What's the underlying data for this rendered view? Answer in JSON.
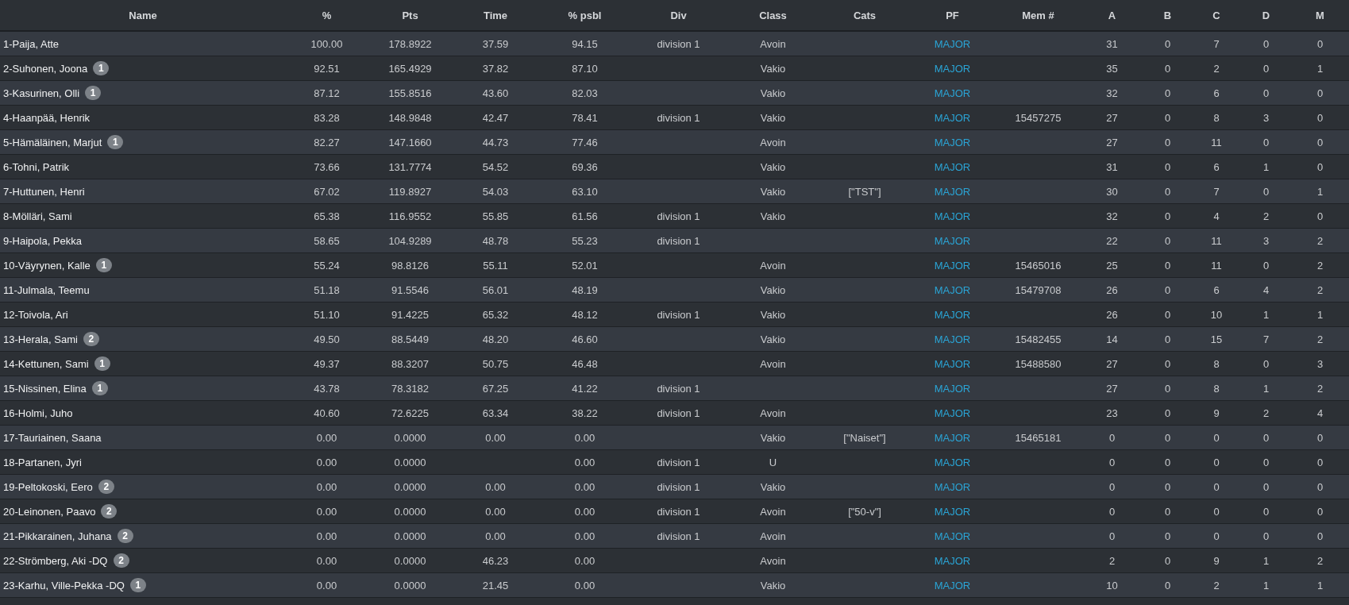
{
  "table": {
    "columns": [
      "Name",
      "%",
      "Pts",
      "Time",
      "% psbl",
      "Div",
      "Class",
      "Cats",
      "PF",
      "Mem #",
      "A",
      "B",
      "C",
      "D",
      "M"
    ],
    "rows": [
      {
        "cells": [
          "1-Paija, Atte",
          "100.00",
          "178.8922",
          "37.59",
          "94.15",
          "division 1",
          "Avoin",
          null,
          "MAJOR",
          null,
          "31",
          "0",
          "7",
          "0",
          "0"
        ]
      },
      {
        "badge": "1",
        "cells": [
          "2-Suhonen, Joona",
          "92.51",
          "165.4929",
          "37.82",
          "87.10",
          null,
          "Vakio",
          null,
          "MAJOR",
          null,
          "35",
          "0",
          "2",
          "0",
          "1"
        ]
      },
      {
        "badge": "1",
        "cells": [
          "3-Kasurinen, Olli",
          "87.12",
          "155.8516",
          "43.60",
          "82.03",
          null,
          "Vakio",
          null,
          "MAJOR",
          null,
          "32",
          "0",
          "6",
          "0",
          "0"
        ]
      },
      {
        "cells": [
          "4-Haanpää, Henrik",
          "83.28",
          "148.9848",
          "42.47",
          "78.41",
          "division 1",
          "Vakio",
          null,
          "MAJOR",
          "15457275",
          "27",
          "0",
          "8",
          "3",
          "0"
        ]
      },
      {
        "badge": "1",
        "cells": [
          "5-Hämäläinen, Marjut",
          "82.27",
          "147.1660",
          "44.73",
          "77.46",
          null,
          "Avoin",
          null,
          "MAJOR",
          null,
          "27",
          "0",
          "11",
          "0",
          "0"
        ]
      },
      {
        "cells": [
          "6-Tohni, Patrik",
          "73.66",
          "131.7774",
          "54.52",
          "69.36",
          null,
          "Vakio",
          null,
          "MAJOR",
          null,
          "31",
          "0",
          "6",
          "1",
          "0"
        ]
      },
      {
        "cells": [
          "7-Huttunen, Henri",
          "67.02",
          "119.8927",
          "54.03",
          "63.10",
          null,
          "Vakio",
          "[\"TST\"]",
          "MAJOR",
          null,
          "30",
          "0",
          "7",
          "0",
          "1"
        ]
      },
      {
        "cells": [
          "8-Mölläri, Sami",
          "65.38",
          "116.9552",
          "55.85",
          "61.56",
          "division 1",
          "Vakio",
          null,
          "MAJOR",
          null,
          "32",
          "0",
          "4",
          "2",
          "0"
        ]
      },
      {
        "cells": [
          "9-Haipola, Pekka",
          "58.65",
          "104.9289",
          "48.78",
          "55.23",
          "division 1",
          null,
          null,
          "MAJOR",
          null,
          "22",
          "0",
          "11",
          "3",
          "2"
        ]
      },
      {
        "badge": "1",
        "cells": [
          "10-Väyrynen, Kalle",
          "55.24",
          "98.8126",
          "55.11",
          "52.01",
          null,
          "Avoin",
          null,
          "MAJOR",
          "15465016",
          "25",
          "0",
          "11",
          "0",
          "2"
        ]
      },
      {
        "cells": [
          "11-Julmala, Teemu",
          "51.18",
          "91.5546",
          "56.01",
          "48.19",
          null,
          "Vakio",
          null,
          "MAJOR",
          "15479708",
          "26",
          "0",
          "6",
          "4",
          "2"
        ]
      },
      {
        "cells": [
          "12-Toivola, Ari",
          "51.10",
          "91.4225",
          "65.32",
          "48.12",
          "division 1",
          "Vakio",
          null,
          "MAJOR",
          null,
          "26",
          "0",
          "10",
          "1",
          "1"
        ]
      },
      {
        "badge": "2",
        "cells": [
          "13-Herala, Sami",
          "49.50",
          "88.5449",
          "48.20",
          "46.60",
          null,
          "Vakio",
          null,
          "MAJOR",
          "15482455",
          "14",
          "0",
          "15",
          "7",
          "2"
        ]
      },
      {
        "badge": "1",
        "cells": [
          "14-Kettunen, Sami",
          "49.37",
          "88.3207",
          "50.75",
          "46.48",
          null,
          "Avoin",
          null,
          "MAJOR",
          "15488580",
          "27",
          "0",
          "8",
          "0",
          "3"
        ]
      },
      {
        "badge": "1",
        "cells": [
          "15-Nissinen, Elina",
          "43.78",
          "78.3182",
          "67.25",
          "41.22",
          "division 1",
          null,
          null,
          "MAJOR",
          null,
          "27",
          "0",
          "8",
          "1",
          "2"
        ]
      },
      {
        "cells": [
          "16-Holmi, Juho",
          "40.60",
          "72.6225",
          "63.34",
          "38.22",
          "division 1",
          "Avoin",
          null,
          "MAJOR",
          null,
          "23",
          "0",
          "9",
          "2",
          "4"
        ]
      },
      {
        "cells": [
          "17-Tauriainen, Saana",
          "0.00",
          "0.0000",
          "0.00",
          "0.00",
          null,
          "Vakio",
          "[\"Naiset\"]",
          "MAJOR",
          "15465181",
          "0",
          "0",
          "0",
          "0",
          "0"
        ]
      },
      {
        "cells": [
          "18-Partanen, Jyri",
          "0.00",
          "0.0000",
          null,
          "0.00",
          "division 1",
          "U",
          null,
          "MAJOR",
          null,
          "0",
          "0",
          "0",
          "0",
          "0"
        ]
      },
      {
        "badge": "2",
        "cells": [
          "19-Peltokoski, Eero",
          "0.00",
          "0.0000",
          "0.00",
          "0.00",
          "division 1",
          "Vakio",
          null,
          "MAJOR",
          null,
          "0",
          "0",
          "0",
          "0",
          "0"
        ]
      },
      {
        "badge": "2",
        "cells": [
          "20-Leinonen, Paavo",
          "0.00",
          "0.0000",
          "0.00",
          "0.00",
          "division 1",
          "Avoin",
          "[\"50-v\"]",
          "MAJOR",
          null,
          "0",
          "0",
          "0",
          "0",
          "0"
        ]
      },
      {
        "badge": "2",
        "cells": [
          "21-Pikkarainen, Juhana",
          "0.00",
          "0.0000",
          "0.00",
          "0.00",
          "division 1",
          "Avoin",
          null,
          "MAJOR",
          null,
          "0",
          "0",
          "0",
          "0",
          "0"
        ]
      },
      {
        "badge": "2",
        "cells": [
          "22-Strömberg, Aki -DQ",
          "0.00",
          "0.0000",
          "46.23",
          "0.00",
          null,
          "Avoin",
          null,
          "MAJOR",
          null,
          "2",
          "0",
          "9",
          "1",
          "2"
        ]
      },
      {
        "badge": "1",
        "cells": [
          "23-Karhu, Ville-Pekka -DQ",
          "0.00",
          "0.0000",
          "21.45",
          "0.00",
          null,
          "Vakio",
          null,
          "MAJOR",
          null,
          "10",
          "0",
          "2",
          "1",
          "1"
        ]
      }
    ]
  }
}
